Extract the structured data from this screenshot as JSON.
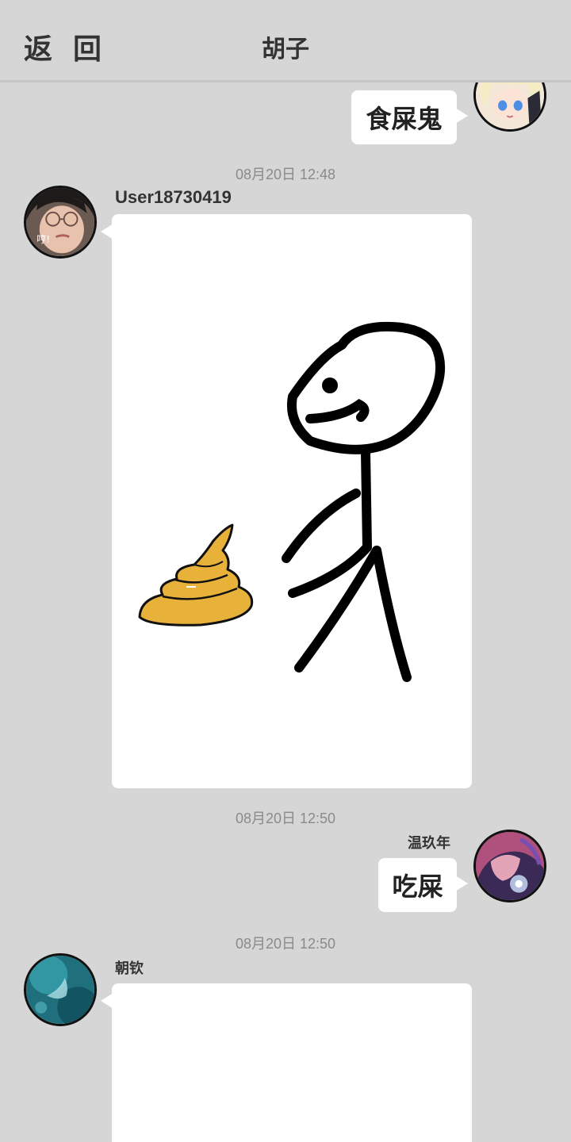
{
  "header": {
    "back_label": "返 回",
    "title": "胡子"
  },
  "messages": [
    {
      "side": "right",
      "type": "text",
      "text": "食屎鬼",
      "avatar": "anime-blonde-avatar"
    },
    {
      "timestamp": "08月20日  12:48",
      "side": "left",
      "sender": "User18730419",
      "type": "image",
      "image_desc": "stick-figure-with-poop-drawing",
      "avatar": "photo-girl-glasses-avatar",
      "avatar_text": "哼!"
    },
    {
      "timestamp": "08月20日  12:50",
      "side": "right",
      "sender": "温玖年",
      "type": "text",
      "text": "吃屎",
      "avatar": "anime-pink-hair-avatar"
    },
    {
      "timestamp": "08月20日  12:50",
      "side": "left",
      "sender": "朝钦",
      "type": "image",
      "image_desc": "blank-white-image",
      "avatar": "teal-abstract-avatar"
    }
  ],
  "colors": {
    "background": "#d6d6d6",
    "bubble": "#ffffff",
    "poop": "#e8b13a",
    "ink": "#000000"
  }
}
